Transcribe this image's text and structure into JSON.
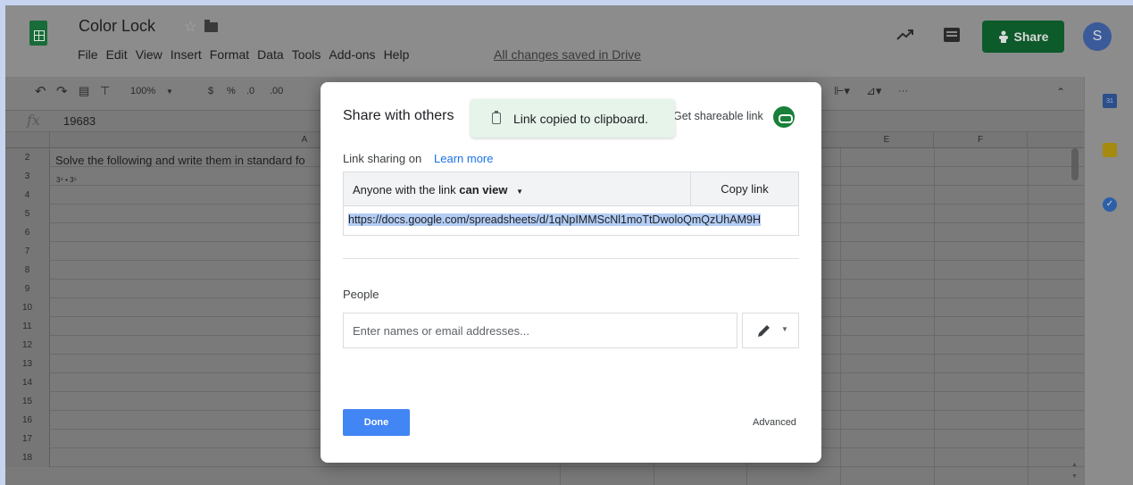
{
  "header": {
    "doc_title": "Color Lock",
    "menu": [
      "File",
      "Edit",
      "View",
      "Insert",
      "Format",
      "Data",
      "Tools",
      "Add-ons",
      "Help"
    ],
    "saved_status": "All changes saved in Drive",
    "share_label": "Share",
    "avatar_letter": "S"
  },
  "toolbar": {
    "zoom": "100%",
    "currency": "$",
    "percent": "%",
    "dec_decrease": ".0",
    "dec_increase": ".00",
    "more": "···"
  },
  "formula_bar": {
    "fx": "fx",
    "value": "19683"
  },
  "grid": {
    "columns": [
      "A",
      "E",
      "F"
    ],
    "row_numbers": [
      "2",
      "3",
      "4",
      "5",
      "6",
      "7",
      "8",
      "9",
      "10",
      "11",
      "12",
      "13",
      "14",
      "15",
      "16",
      "17",
      "18"
    ],
    "cell_a2": "Solve the following and write them in standard fo",
    "cell_a3": "3⁴ • 3⁵"
  },
  "sidepanel": {
    "calendar_label": "31"
  },
  "dialog": {
    "title": "Share with others",
    "toast": "Link copied to clipboard.",
    "get_link": "Get shareable link",
    "link_sharing_label": "Link sharing on",
    "learn_more": "Learn more",
    "sharing_prefix": "Anyone with the link ",
    "sharing_level": "can view",
    "copy_link": "Copy link",
    "url": "https://docs.google.com/spreadsheets/d/1qNpIMMScNl1moTtDwoloQmQzUhAM9H",
    "people_label": "People",
    "people_placeholder": "Enter names or email addresses...",
    "done": "Done",
    "advanced": "Advanced"
  },
  "colors": {
    "share_button": "#0d5a2b",
    "done_button": "#4285f4",
    "link_icon": "#188038",
    "toast_bg": "#e6f4ea",
    "url_highlight": "#b3cdf5"
  }
}
